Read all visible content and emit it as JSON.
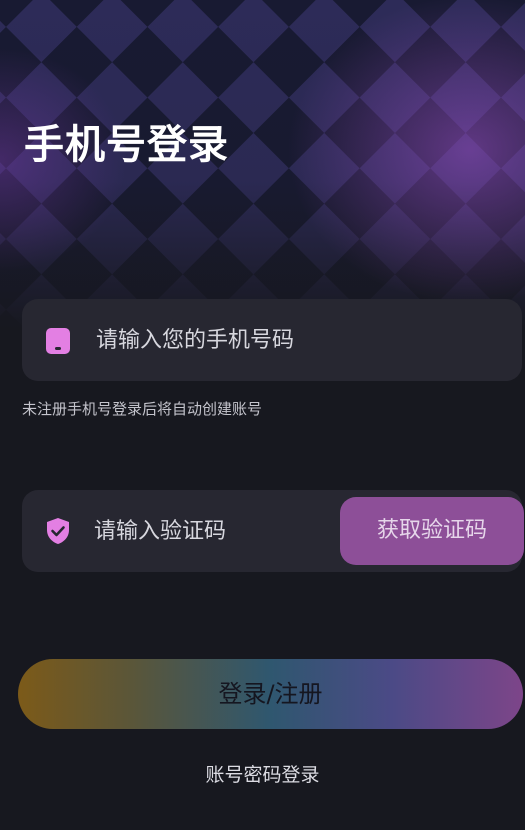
{
  "header": {
    "title": "手机号登录"
  },
  "phone_field": {
    "icon": "phone-icon",
    "placeholder": "请输入您的手机号码",
    "value": ""
  },
  "hint": "未注册手机号登录后将自动创建账号",
  "code_field": {
    "icon": "shield-check-icon",
    "placeholder": "请输入验证码",
    "value": "",
    "get_code_label": "获取验证码"
  },
  "login_button": {
    "label": "登录/注册"
  },
  "alt_login": {
    "label": "账号密码登录"
  },
  "colors": {
    "background": "#17181f",
    "field_background": "#272731",
    "accent_purple": "#8d4f98",
    "icon_pink": "#e37fe3",
    "gradient_start": "#7c5a19",
    "gradient_mid": "#2f576f",
    "gradient_end": "#7d4589"
  }
}
